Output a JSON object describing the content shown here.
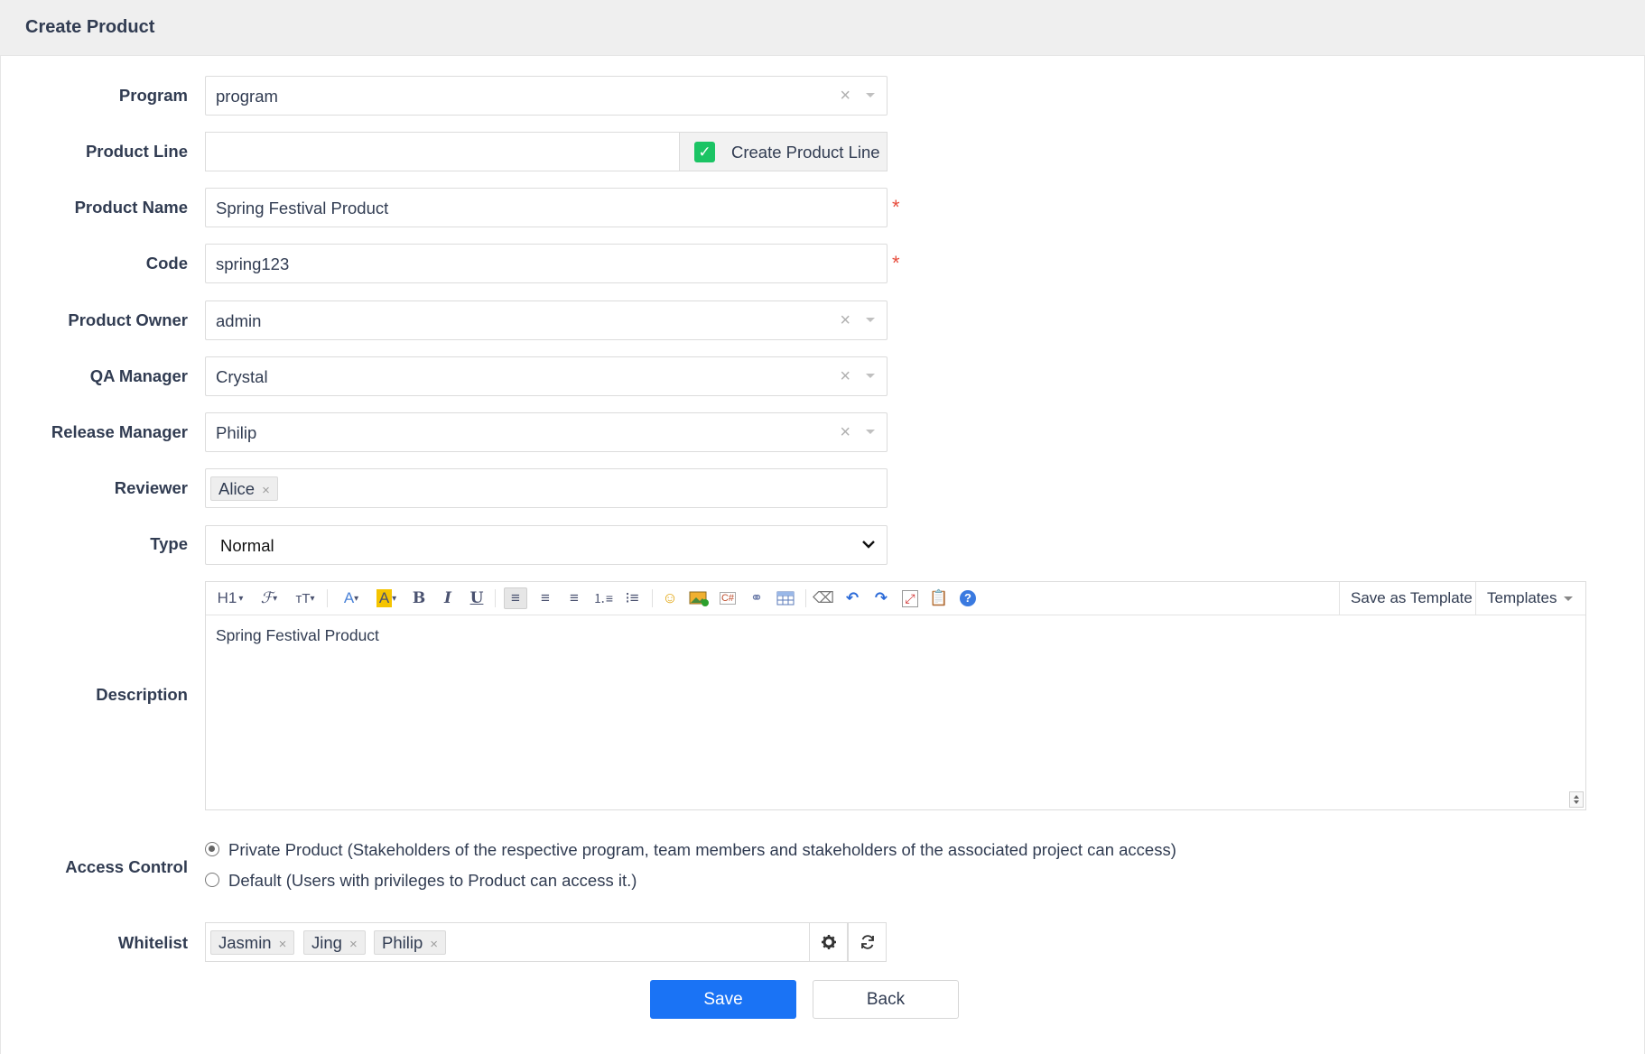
{
  "header": {
    "title": "Create Product"
  },
  "form": {
    "program": {
      "label": "Program",
      "value": "program"
    },
    "product_line": {
      "label": "Product Line",
      "value": "",
      "addon_label": "Create Product Line",
      "addon_checked": true
    },
    "product_name": {
      "label": "Product Name",
      "value": "Spring Festival Product",
      "required_mark": "*"
    },
    "code": {
      "label": "Code",
      "value": "spring123",
      "required_mark": "*"
    },
    "product_owner": {
      "label": "Product Owner",
      "value": "admin"
    },
    "qa_manager": {
      "label": "QA Manager",
      "value": "Crystal"
    },
    "release_manager": {
      "label": "Release Manager",
      "value": "Philip"
    },
    "reviewer": {
      "label": "Reviewer",
      "chips": [
        "Alice"
      ]
    },
    "type": {
      "label": "Type",
      "value": "Normal"
    },
    "description": {
      "label": "Description",
      "content": "Spring Festival Product",
      "toolbar": {
        "heading": "H1",
        "save_as_template": "Save as Template",
        "templates": "Templates"
      }
    },
    "access_control": {
      "label": "Access Control",
      "options": [
        {
          "label": "Private Product (Stakeholders of the respective program, team members and stakeholders of the associated project can access)",
          "selected": true
        },
        {
          "label": "Default (Users with privileges to Product can access it.)",
          "selected": false
        }
      ]
    },
    "whitelist": {
      "label": "Whitelist",
      "chips": [
        "Jasmin",
        "Jing",
        "Philip"
      ]
    }
  },
  "actions": {
    "save": "Save",
    "back": "Back"
  },
  "colors": {
    "primary": "#1a73f5",
    "checkbox": "#1bc464",
    "required": "#e74c3c",
    "highlight": "#f5c400"
  }
}
